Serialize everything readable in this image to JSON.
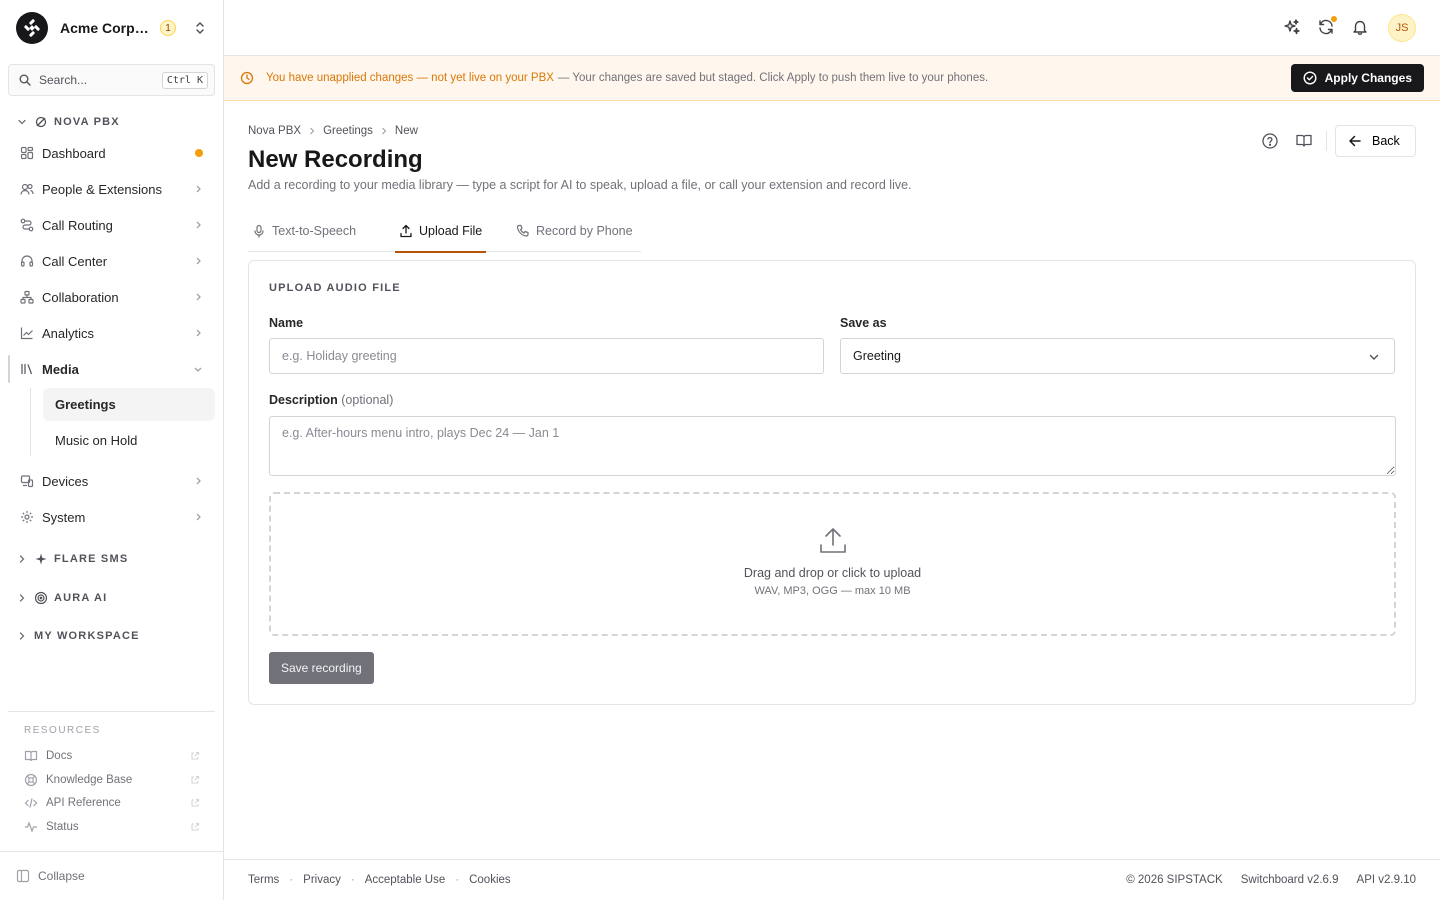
{
  "org": {
    "name": "Acme Corporation",
    "badge": "1"
  },
  "search": {
    "placeholder": "Search...",
    "shortcut": "Ctrl K"
  },
  "sidebar": {
    "sections": [
      {
        "label": "NOVA PBX",
        "expanded": true
      },
      {
        "label": "FLARE SMS",
        "expanded": false
      },
      {
        "label": "AURA AI",
        "expanded": false
      },
      {
        "label": "MY WORKSPACE",
        "expanded": false
      }
    ],
    "items": [
      {
        "label": "Dashboard",
        "icon": "dashboard-icon"
      },
      {
        "label": "People & Extensions",
        "icon": "people-icon"
      },
      {
        "label": "Call Routing",
        "icon": "routing-icon"
      },
      {
        "label": "Call Center",
        "icon": "headset-icon"
      },
      {
        "label": "Collaboration",
        "icon": "collaboration-icon"
      },
      {
        "label": "Analytics",
        "icon": "analytics-icon"
      },
      {
        "label": "Media",
        "icon": "library-icon"
      },
      {
        "label": "Devices",
        "icon": "devices-icon"
      },
      {
        "label": "System",
        "icon": "system-icon"
      }
    ],
    "media_children": [
      {
        "label": "Greetings"
      },
      {
        "label": "Music on Hold"
      }
    ],
    "resources_title": "RESOURCES",
    "resources": [
      {
        "label": "Docs",
        "icon": "book-icon"
      },
      {
        "label": "Knowledge Base",
        "icon": "lifebuoy-icon"
      },
      {
        "label": "API Reference",
        "icon": "code-icon"
      },
      {
        "label": "Status",
        "icon": "activity-icon"
      }
    ],
    "collapse_label": "Collapse"
  },
  "topbar": {
    "avatar_initials": "JS"
  },
  "banner": {
    "warning": "You have unapplied changes — not yet live on your PBX",
    "detail": "— Your changes are saved but staged. Click Apply to push them live to your phones.",
    "apply_label": "Apply Changes"
  },
  "breadcrumb": [
    "Nova PBX",
    "Greetings",
    "New"
  ],
  "page": {
    "title": "New Recording",
    "subtitle": "Add a recording to your media library — type a script for AI to speak, upload a file, or call your extension and record live.",
    "back_label": "Back"
  },
  "tabs": [
    {
      "label": "Text-to-Speech",
      "icon": "mic-icon"
    },
    {
      "label": "Upload File",
      "icon": "upload-icon"
    },
    {
      "label": "Record by Phone",
      "icon": "phone-icon"
    }
  ],
  "form": {
    "section_title": "UPLOAD AUDIO FILE",
    "name_label": "Name",
    "name_placeholder": "e.g. Holiday greeting",
    "saveas_label": "Save as",
    "saveas_value": "Greeting",
    "desc_label": "Description",
    "desc_optional": "(optional)",
    "desc_placeholder": "e.g. After-hours menu intro, plays Dec 24 — Jan 1",
    "drop_main": "Drag and drop or click to upload",
    "drop_sub": "WAV, MP3, OGG — max 10 MB",
    "save_label": "Save recording"
  },
  "footer": {
    "links": [
      "Terms",
      "Privacy",
      "Acceptable Use",
      "Cookies"
    ],
    "copyright": "© 2026 SIPSTACK",
    "switchboard": "Switchboard v2.6.9",
    "api": "API v2.9.10"
  },
  "colors": {
    "accent": "#b45309",
    "warning": "#d97706",
    "dot": "#f59e0b",
    "primary": "#18181b"
  }
}
